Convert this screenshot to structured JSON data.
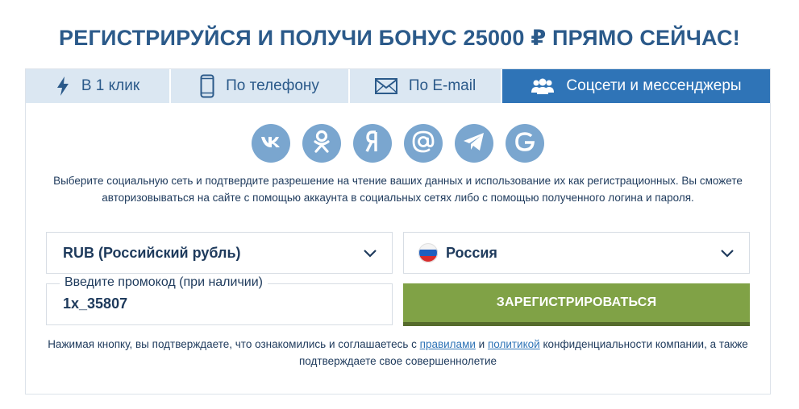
{
  "header": {
    "title": "РЕГИСТРИРУЙСЯ И ПОЛУЧИ БОНУС 25000 ₽ ПРЯМО СЕЙЧАС!"
  },
  "tabs": [
    {
      "label": "В 1 клик",
      "icon": "lightning-icon",
      "active": false
    },
    {
      "label": "По телефону",
      "icon": "phone-icon",
      "active": false
    },
    {
      "label": "По E-mail",
      "icon": "envelope-icon",
      "active": false
    },
    {
      "label": "Соцсети и мессенджеры",
      "icon": "people-icon",
      "active": true
    }
  ],
  "socials": [
    {
      "name": "vk",
      "icon": "vk-icon"
    },
    {
      "name": "odnoklassniki",
      "icon": "odnoklassniki-icon"
    },
    {
      "name": "yandex",
      "icon": "yandex-icon"
    },
    {
      "name": "mail",
      "icon": "at-icon"
    },
    {
      "name": "telegram",
      "icon": "telegram-icon"
    },
    {
      "name": "google",
      "icon": "google-icon"
    }
  ],
  "description": "Выберите социальную сеть и подтвердите разрешение на чтение ваших данных и использование их как регистрационных. Вы сможете авторизовываться на сайте с помощью аккаунта в социальных сетях либо с помощью полученного логина и пароля.",
  "form": {
    "currency": "RUB (Российский рубль)",
    "country": "Россия",
    "promo_label": "Введите промокод (при наличии)",
    "promo_value": "1x_35807",
    "register_button": "ЗАРЕГИСТРИРОВАТЬСЯ"
  },
  "terms": {
    "prefix": "Нажимая кнопку, вы подтверждаете, что ознакомились и соглашаетесь с ",
    "rules_link": "правилами",
    "and": " и ",
    "policy_link": "политикой",
    "suffix": " конфиденциальности компании, а также подтверждаете свое совершеннолетие"
  },
  "colors": {
    "title": "#2b5a8a",
    "tab_active": "#2f74b7",
    "tab_inactive": "#dbe7f2",
    "social_icon": "#7aa6cf",
    "register_button": "#80a246"
  }
}
